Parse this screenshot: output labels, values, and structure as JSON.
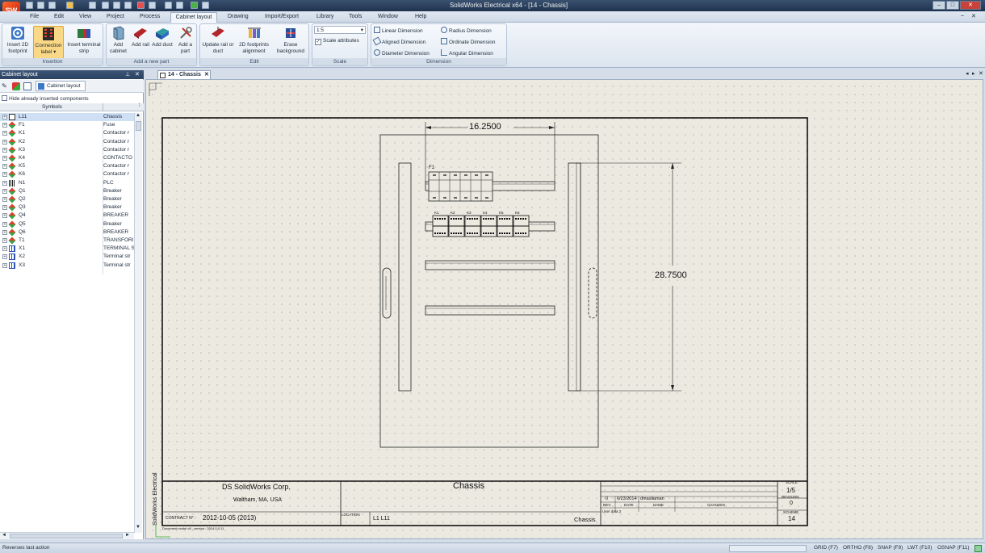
{
  "window": {
    "title": "SolidWorks Electrical x64 - [14 - Chassis]",
    "app_badge": "SW"
  },
  "menu": {
    "tabs": [
      "File",
      "Edit",
      "View",
      "Project",
      "Process",
      "Cabinet layout",
      "Drawing",
      "Import/Export",
      "Library",
      "Tools",
      "Window",
      "Help"
    ],
    "active": "Cabinet layout"
  },
  "ribbon": {
    "insertion": {
      "label": "Insertion",
      "insert_2d_footprint": "Insert 2D footprint",
      "connection_label": "Connection label",
      "insert_terminal_strip": "Insert terminal strip"
    },
    "add_new_part": {
      "label": "Add a new part",
      "add_cabinet": "Add cabinet",
      "add_rail": "Add rail",
      "add_duct": "Add duct",
      "add_part": "Add a part"
    },
    "edit": {
      "label": "Edit",
      "update_rail": "Update rail or duct",
      "footprints_alignment": "2D footprints alignment",
      "erase_background": "Erase background"
    },
    "scale": {
      "label": "Scale",
      "value": "1:5",
      "attributes": "Scale attributes"
    },
    "dimension": {
      "label": "Dimension",
      "linear": "Linear Dimension",
      "aligned": "Aligned Dimension",
      "diameter": "Diameter Dimension",
      "radius": "Radius Dimension",
      "ordinate": "Ordinate Dimension",
      "angular": "Angular Dimension"
    }
  },
  "left_panel": {
    "title": "Cabinet layout",
    "tab_label": "Cabinet layout",
    "hide_inserted": "Hide already inserted components",
    "col_symbols": "Symbols",
    "root": {
      "name": "L11",
      "desc": "Chassis"
    },
    "items": [
      {
        "name": "F1",
        "desc": "Fuse"
      },
      {
        "name": "K1",
        "desc": "Contactor r"
      },
      {
        "name": "K2",
        "desc": "Contactor r"
      },
      {
        "name": "K3",
        "desc": "Contactor r"
      },
      {
        "name": "K4",
        "desc": "CONTACTO"
      },
      {
        "name": "K5",
        "desc": "Contactor r"
      },
      {
        "name": "K6",
        "desc": "Contactor r"
      },
      {
        "name": "N1",
        "desc": "PLC"
      },
      {
        "name": "Q1",
        "desc": "Breaker"
      },
      {
        "name": "Q2",
        "desc": "Breaker"
      },
      {
        "name": "Q3",
        "desc": "Breaker"
      },
      {
        "name": "Q4",
        "desc": "BREAKER"
      },
      {
        "name": "Q5",
        "desc": "Breaker"
      },
      {
        "name": "Q6",
        "desc": "BREAKER"
      },
      {
        "name": "T1",
        "desc": "TRANSFORI"
      },
      {
        "name": "X1",
        "desc": "TERMINAL S"
      },
      {
        "name": "X2",
        "desc": "Terminal str"
      },
      {
        "name": "X3",
        "desc": "Terminal str"
      }
    ]
  },
  "document": {
    "tab": "14 - Chassis",
    "dim_horizontal": "16.2500",
    "dim_vertical": "28.7500",
    "fuse_label": "F1",
    "contactor_labels": [
      "K1",
      "K2",
      "K3",
      "K4",
      "K5",
      "K6"
    ],
    "title_block": {
      "company": "DS SolidWorks Corp.",
      "address": "Waltham, MA, USA",
      "contract_label": "CONTRACT N° :",
      "contract_value": "2012-10-05 (2013)",
      "location_label": "LOCATION",
      "location_value": "L1 L11",
      "title": "Chassis",
      "title_small": "Chassis",
      "rev_row": {
        "rev": "0",
        "date": "6/23/2014",
        "name": "dmasliaman"
      },
      "headers": {
        "rev": "REV.",
        "date": "DATE",
        "name": "NAME",
        "changes": "CHANGES"
      },
      "user_data": "User data 2",
      "scale_label": "SCALE",
      "scale_value": "1/5",
      "revision_label": "REVISION",
      "revision_value": "0",
      "scheme_label": "SCHEME",
      "scheme_value": "14",
      "side_text": "SolidWorks Electrical",
      "footer_note": "Document model v8 - version : 2014.0.0.11"
    }
  },
  "status": {
    "message": "Reverses last action",
    "grid": "GRID (F7)",
    "ortho": "ORTHO (F8)",
    "snap": "SNAP (F9)",
    "lwt": "LWT (F10)",
    "osnap": "OSNAP (F11)"
  }
}
